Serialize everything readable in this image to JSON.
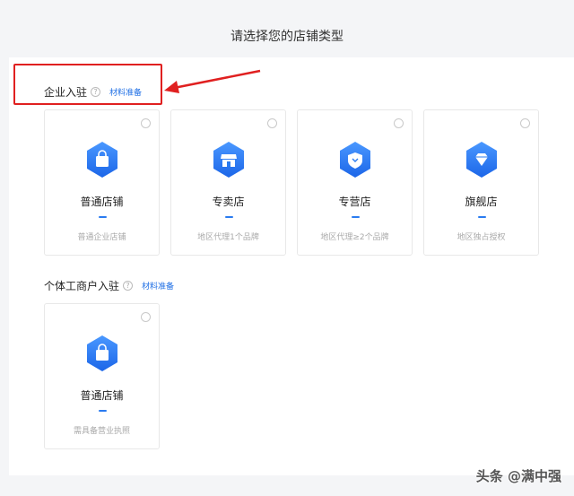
{
  "page": {
    "title": "请选择您的店铺类型"
  },
  "sections": {
    "enterprise": {
      "title": "企业入驻",
      "help_icon": "question-circle-icon",
      "link": "材料准备",
      "cards": [
        {
          "name": "普通店铺",
          "desc": "普通企业店铺",
          "icon": "shopping-bag-icon"
        },
        {
          "name": "专卖店",
          "desc": "地区代理1个品牌",
          "icon": "storefront-icon"
        },
        {
          "name": "专营店",
          "desc": "地区代理≥2个品牌",
          "icon": "shield-badge-icon"
        },
        {
          "name": "旗舰店",
          "desc": "地区独占授权",
          "icon": "diamond-icon"
        }
      ]
    },
    "individual": {
      "title": "个体工商户入驻",
      "help_icon": "question-circle-icon",
      "link": "材料准备",
      "cards": [
        {
          "name": "普通店铺",
          "desc": "需具备营业执照",
          "icon": "shopping-bag-icon"
        }
      ]
    }
  },
  "watermark": "头条 @满中强",
  "colors": {
    "accent": "#1f6fe5",
    "highlight": "#e02020",
    "background": "#f4f5f7"
  }
}
